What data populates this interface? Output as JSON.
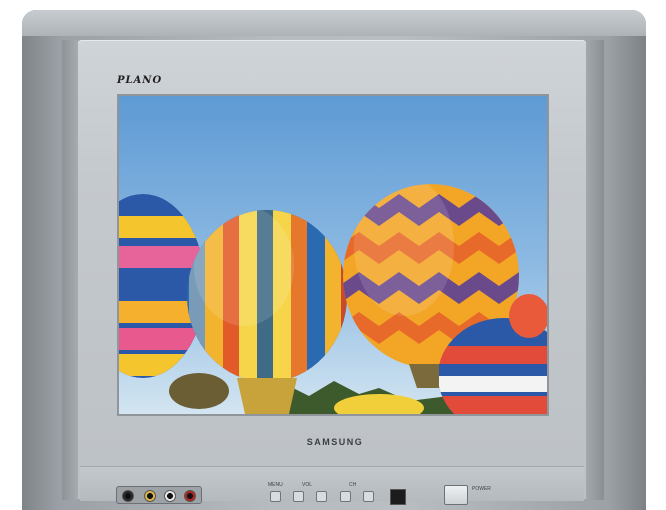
{
  "tv": {
    "model_badge": "PLANO",
    "brand_badge": "SAMSUNG",
    "panel_labels": {
      "menu": "MENU",
      "vol": "VOL",
      "ch": "CH",
      "power": "POWER"
    }
  },
  "colors": {
    "cabinet": "#b6bbbf",
    "bezel": "#c4c9cd",
    "sky_top": "#6fa6d8",
    "sky_bottom": "#c9dff0"
  },
  "screen_content": {
    "subject": "hot-air-balloons"
  }
}
